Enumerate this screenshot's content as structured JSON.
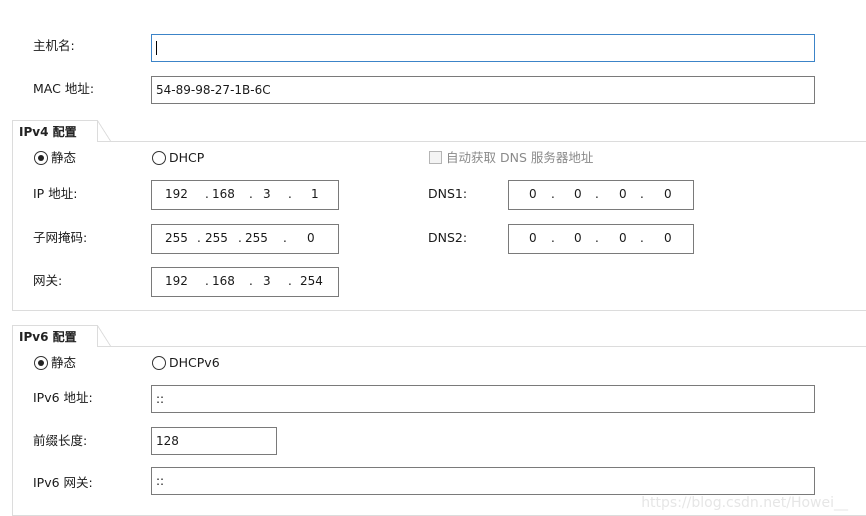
{
  "host": {
    "hostname_label": "主机名:",
    "hostname_value": "",
    "mac_label": "MAC 地址:",
    "mac_value": "54-89-98-27-1B-6C"
  },
  "ipv4": {
    "title": "IPv4 配置",
    "static_label": "静态",
    "dhcp_label": "DHCP",
    "selected": "static",
    "auto_dns_label": "自动获取 DNS 服务器地址",
    "ip_label": "IP 地址:",
    "ip": [
      "192",
      "168",
      "3",
      "1"
    ],
    "mask_label": "子网掩码:",
    "mask": [
      "255",
      "255",
      "255",
      "0"
    ],
    "gateway_label": "网关:",
    "gateway": [
      "192",
      "168",
      "3",
      "254"
    ],
    "dns1_label": "DNS1:",
    "dns1": [
      "0",
      "0",
      "0",
      "0"
    ],
    "dns2_label": "DNS2:",
    "dns2": [
      "0",
      "0",
      "0",
      "0"
    ]
  },
  "ipv6": {
    "title": "IPv6 配置",
    "static_label": "静态",
    "dhcp_label": "DHCPv6",
    "selected": "static",
    "addr_label": "IPv6 地址:",
    "addr_value": "::",
    "prefix_label": "前缀长度:",
    "prefix_value": "128",
    "gateway_label": "IPv6 网关:",
    "gateway_value": "::"
  },
  "watermark": "https://blog.csdn.net/Howei__"
}
